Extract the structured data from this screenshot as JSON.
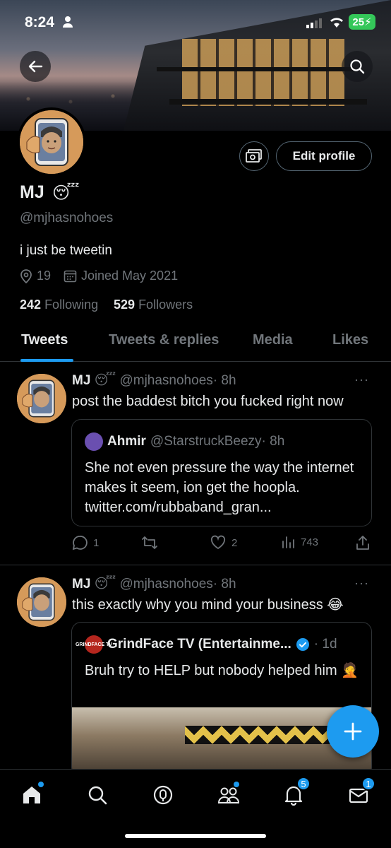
{
  "status_bar": {
    "time": "8:24",
    "battery": "25"
  },
  "profile": {
    "name": "MJ",
    "name_emoji": "😴",
    "handle": "@mjhasnohoes",
    "bio": "i just be tweetin",
    "location": "19",
    "joined": "Joined May 2021",
    "following_count": "242",
    "following_label": "Following",
    "followers_count": "529",
    "followers_label": "Followers",
    "edit_label": "Edit profile"
  },
  "tabs": [
    {
      "label": "Tweets",
      "active": true
    },
    {
      "label": "Tweets & replies"
    },
    {
      "label": "Media"
    },
    {
      "label": "Likes"
    }
  ],
  "tweets": [
    {
      "name": "MJ",
      "emoji": "😴",
      "handle": "@mjhasnohoes",
      "time": "· 8h",
      "text": "post the baddest bitch you fucked right now",
      "quote": {
        "name": "Ahmir",
        "handle": "@StarstruckBeezy",
        "time": "· 8h",
        "text": "She not even pressure the way the internet makes it seem, ion get the hoopla. twitter.com/rubbaband_gran..."
      },
      "replies": "1",
      "likes": "2",
      "views": "743"
    },
    {
      "name": "MJ",
      "emoji": "😴",
      "handle": "@mjhasnohoes",
      "time": "· 8h",
      "text": "this exactly why you mind your business 😂",
      "quote": {
        "name": "GrindFace TV (Entertainme...",
        "avatar_text": "GRINDFACE TV",
        "time": "· 1d",
        "text": "Bruh try to HELP but nobody helped him 🤦"
      }
    }
  ],
  "nav": {
    "notifications_badge": "5",
    "messages_badge": "1"
  },
  "colors": {
    "accent": "#1d9bf0",
    "background": "#000000",
    "muted": "#71767b"
  }
}
